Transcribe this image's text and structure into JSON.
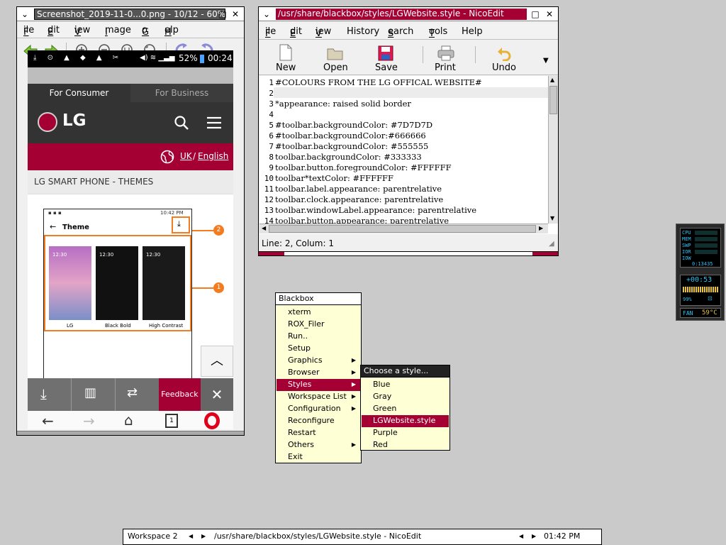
{
  "viewer": {
    "title": "Screenshot_2019-11-0...0.png - 10/12 - 60%",
    "menus": [
      "File",
      "Edit",
      "View",
      "Image",
      "Go",
      "Help"
    ],
    "toolbar_icons": [
      "back-arrow-icon",
      "forward-arrow-icon",
      "zoom-in-icon",
      "zoom-out-icon",
      "zoom-fit-icon",
      "zoom-original-icon",
      "rotate-left-icon",
      "rotate-right-icon"
    ]
  },
  "phone": {
    "battery": "52%",
    "time": "00:24",
    "tab_consumer": "For Consumer",
    "tab_business": "For Business",
    "logo": "LG",
    "region_uk": "UK",
    "region_sep": "/",
    "region_lang": "English",
    "section_title": "LG SMART PHONE - THEMES",
    "inner_time": "10:42 PM",
    "inner_title": "Theme",
    "thumb_labels": [
      "LG",
      "Black Bold",
      "High Contrast"
    ],
    "thumb_times": [
      "12:30",
      "12:30",
      "12:30"
    ],
    "badge1": "1",
    "badge2": "2",
    "feedback": "Feedback"
  },
  "editor": {
    "title": "/usr/share/blackbox/styles/LGWebsite.style - NicoEdit",
    "menus": [
      "File",
      "Edit",
      "View",
      "History",
      "Search",
      "Tools",
      "Help"
    ],
    "toolbar": [
      {
        "label": "New",
        "icon": "new-file-icon"
      },
      {
        "label": "Open",
        "icon": "open-folder-icon"
      },
      {
        "label": "Save",
        "icon": "save-disk-icon"
      },
      {
        "label": "Print",
        "icon": "printer-icon"
      },
      {
        "label": "Undo",
        "icon": "undo-icon"
      }
    ],
    "lines": [
      {
        "n": "1",
        "text": "#COLOURS FROM THE LG OFFICAL WEBSITE#"
      },
      {
        "n": "2",
        "text": ""
      },
      {
        "n": "3",
        "text": "*appearance: raised solid border"
      },
      {
        "n": "4",
        "text": ""
      },
      {
        "n": "5",
        "text": "#toolbar.backgroundColor: #7D7D7D"
      },
      {
        "n": "6",
        "text": "#toolbar.backgroundColor:#666666"
      },
      {
        "n": "7",
        "text": "#toolbar.backgroundColor: #555555"
      },
      {
        "n": "8",
        "text": "toolbar.backgroundColor: #333333"
      },
      {
        "n": "9",
        "text": "toolbar.button.foregroundColor: #FFFFFF"
      },
      {
        "n": "10",
        "text": "toolbar*textColor: #FFFFFF"
      },
      {
        "n": "11",
        "text": "toolbar.label.appearance: parentrelative"
      },
      {
        "n": "12",
        "text": "toolbar.clock.appearance: parentrelative"
      },
      {
        "n": "13",
        "text": "toolbar.windowLabel.appearance: parentrelative"
      },
      {
        "n": "14",
        "text": "toolbar.button.appearance: parentrelative"
      }
    ],
    "status": "Line: 2, Colum: 1"
  },
  "rootmenu": {
    "title": "Blackbox",
    "items": [
      {
        "label": "xterm",
        "sub": false
      },
      {
        "label": "ROX_Filer",
        "sub": false
      },
      {
        "label": "Run..",
        "sub": false
      },
      {
        "label": "Setup",
        "sub": false
      },
      {
        "label": "Graphics",
        "sub": true
      },
      {
        "label": "Browser",
        "sub": true
      },
      {
        "label": "Styles",
        "sub": true
      },
      {
        "label": "Workspace List",
        "sub": true
      },
      {
        "label": "Configuration",
        "sub": true
      },
      {
        "label": "Reconfigure",
        "sub": false
      },
      {
        "label": "Restart",
        "sub": false
      },
      {
        "label": "Others",
        "sub": true
      },
      {
        "label": "Exit",
        "sub": false
      }
    ],
    "selected": "Styles"
  },
  "stylemenu": {
    "title": "Choose a style...",
    "items": [
      "Blue",
      "Gray",
      "Green",
      "LGWebsite.style",
      "Purple",
      "Red"
    ],
    "selected": "LGWebsite.style"
  },
  "taskbar": {
    "workspace": "Workspace 2",
    "window": "/usr/share/blackbox/styles/LGWebsite.style - NicoEdit",
    "clock": "01:42 PM"
  },
  "dock": {
    "labels": [
      "CPU",
      "MEM",
      "SWP",
      "IOR",
      "IOW"
    ],
    "uptime": "0:13435",
    "temp_time": "+00:53",
    "battery": "99%",
    "fan": "FAN",
    "cpu_temp": "59°C"
  },
  "colors": {
    "accent": "#a50034",
    "menu_bg": "#ffffd6",
    "dock_text": "#2bc2f4"
  }
}
